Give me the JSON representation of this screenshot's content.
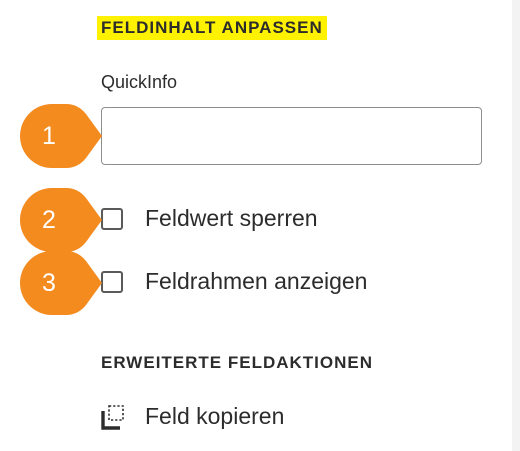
{
  "customize_section": {
    "heading": "FELDINHALT ANPASSEN",
    "quickinfo_label": "QuickInfo",
    "quickinfo_value": "",
    "lock_field_value_label": "Feldwert sperren",
    "lock_field_value_checked": false,
    "show_field_border_label": "Feldrahmen anzeigen",
    "show_field_border_checked": false
  },
  "advanced_section": {
    "heading": "ERWEITERTE FELDAKTIONEN",
    "copy_field_label": "Feld kopieren",
    "copy_field_icon": "copy-field-icon"
  },
  "callouts": [
    "1",
    "2",
    "3"
  ],
  "colors": {
    "callout": "#f38b1f",
    "highlight": "#fff200",
    "text": "#2c2c2c"
  }
}
